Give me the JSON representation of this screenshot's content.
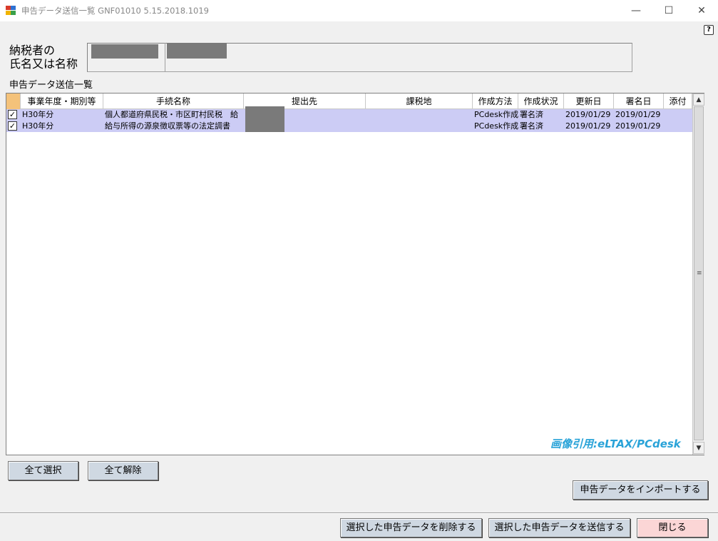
{
  "window": {
    "title": "申告データ送信一覧 GNF01010 5.15.2018.1019",
    "minimize_glyph": "—",
    "maximize_glyph": "☐",
    "close_glyph": "✕",
    "help_glyph": "?"
  },
  "taxpayer": {
    "label_line1": "納税者の",
    "label_line2": "氏名又は名称"
  },
  "section": {
    "label": "申告データ送信一覧"
  },
  "grid": {
    "columns": [
      "事業年度・期別等",
      "手続名称",
      "提出先",
      "課税地",
      "作成方法",
      "作成状況",
      "更新日",
      "署名日",
      "添付"
    ],
    "rows": [
      {
        "checked": true,
        "period": "H30年分",
        "procedure": "個人都道府県民税・市区町村民税　給",
        "submit_to": "",
        "tax_place": "",
        "method": "PCdesk作成",
        "status": "署名済",
        "updated": "2019/01/29",
        "signed": "2019/01/29",
        "attach": ""
      },
      {
        "checked": true,
        "period": "H30年分",
        "procedure": "給与所得の源泉徴収票等の法定調書",
        "submit_to": "",
        "tax_place": "",
        "method": "PCdesk作成",
        "status": "署名済",
        "updated": "2019/01/29",
        "signed": "2019/01/29",
        "attach": ""
      }
    ],
    "check_glyph": "✓",
    "scroll_up_glyph": "▲",
    "scroll_down_glyph": "▼",
    "thumb_glyph": "≡"
  },
  "watermark": "画像引用:eLTAX/PCdesk",
  "buttons": {
    "select_all": "全て選択",
    "deselect_all": "全て解除",
    "import": "申告データをインポートする",
    "delete_selected": "選択した申告データを削除する",
    "send_selected": "選択した申告データを送信する",
    "close": "閉じる"
  }
}
